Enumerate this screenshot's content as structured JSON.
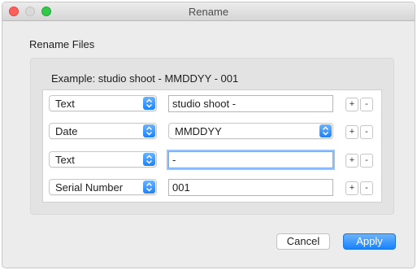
{
  "window": {
    "title": "Rename"
  },
  "heading": "Rename Files",
  "example": "Example: studio shoot - MMDDYY - 001",
  "rows": [
    {
      "type": "Text",
      "value": "studio shoot -",
      "plus": "+",
      "minus": "-"
    },
    {
      "type": "Date",
      "format": "MMDDYY",
      "plus": "+",
      "minus": "-"
    },
    {
      "type": "Text",
      "value": "-",
      "plus": "+",
      "minus": "-"
    },
    {
      "type": "Serial Number",
      "value": "001",
      "plus": "+",
      "minus": "-"
    }
  ],
  "buttons": {
    "cancel": "Cancel",
    "apply": "Apply"
  },
  "colors": {
    "accent": "#1a82fb",
    "focus_ring": "#9ec4f4"
  }
}
